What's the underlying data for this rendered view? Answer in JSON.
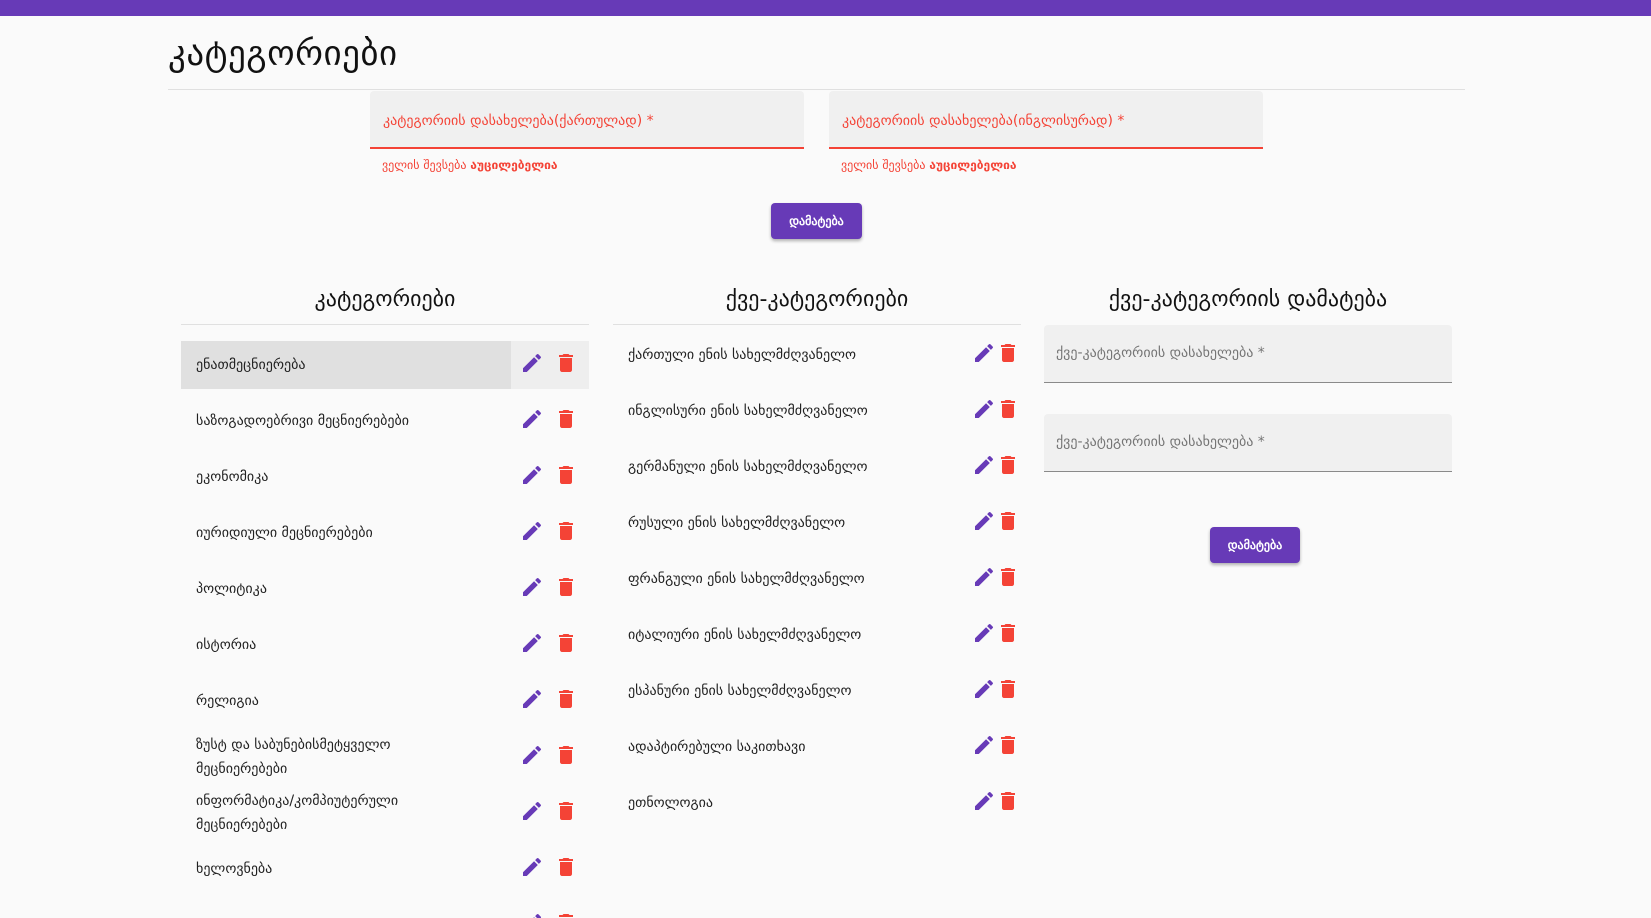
{
  "page": {
    "title": "კატეგორიები"
  },
  "form": {
    "field_ka_label": "კატეგორიის დასახელება(ქართულად) *",
    "field_en_label": "კატეგორიის დასახელება(ინგლისურად) *",
    "error_prefix": "ველის შევსება ",
    "error_bold": "აუცილებელია",
    "add_button": "დამატება"
  },
  "categories": {
    "title": "კატეგორიები",
    "items": [
      "ენათმეცნიერება",
      "საზოგადოებრივი მეცნიერებები",
      "ეკონომიკა",
      "იურიდიული მეცნიერებები",
      "პოლიტიკა",
      "ისტორია",
      "რელიგია",
      "ზუსტ და საბუნებისმეტყველო მეცნიერებები",
      "ინფორმატიკა/კომპიუტერული მეცნიერებები",
      "ხელოვნება"
    ]
  },
  "subcategories": {
    "title": "ქვე-კატეგორიები",
    "items": [
      "ქართული ენის სახელმძღვანელო",
      "ინგლისური ენის სახელმძღვანელო",
      "გერმანული ენის სახელმძღვანელო",
      "რუსული ენის სახელმძღვანელო",
      "ფრანგული ენის სახელმძღვანელო",
      "იტალიური ენის სახელმძღვანელო",
      "ესპანური ენის სახელმძღვანელო",
      "ადაპტირებული საკითხავი",
      "ეთნოლოგია"
    ]
  },
  "add_subcategory": {
    "title": "ქვე-კატეგორიის დამატება",
    "field1_label": "ქვე-კატეგორიის დასახელება *",
    "field2_label": "ქვე-კატეგორიის დასახელება *",
    "add_button": "დამატება"
  },
  "colors": {
    "accent": "#673ab7",
    "danger": "#f44336"
  }
}
